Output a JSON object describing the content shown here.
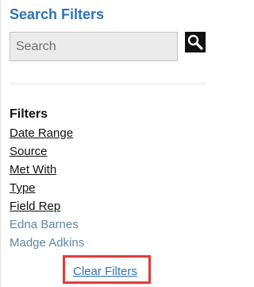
{
  "panel": {
    "title": "Search Filters"
  },
  "search": {
    "placeholder": "Search",
    "value": "",
    "button_icon": "search-icon"
  },
  "filters": {
    "heading": "Filters",
    "links": [
      "Date Range",
      "Source",
      "Met With",
      "Type",
      "Field Rep"
    ],
    "selected_values": [
      "Edna Barnes",
      "Madge Adkins"
    ],
    "clear_label": "Clear Filters"
  },
  "colors": {
    "accent": "#2f73b6",
    "value_text": "#5f87a6",
    "highlight": "#e23a3a"
  }
}
